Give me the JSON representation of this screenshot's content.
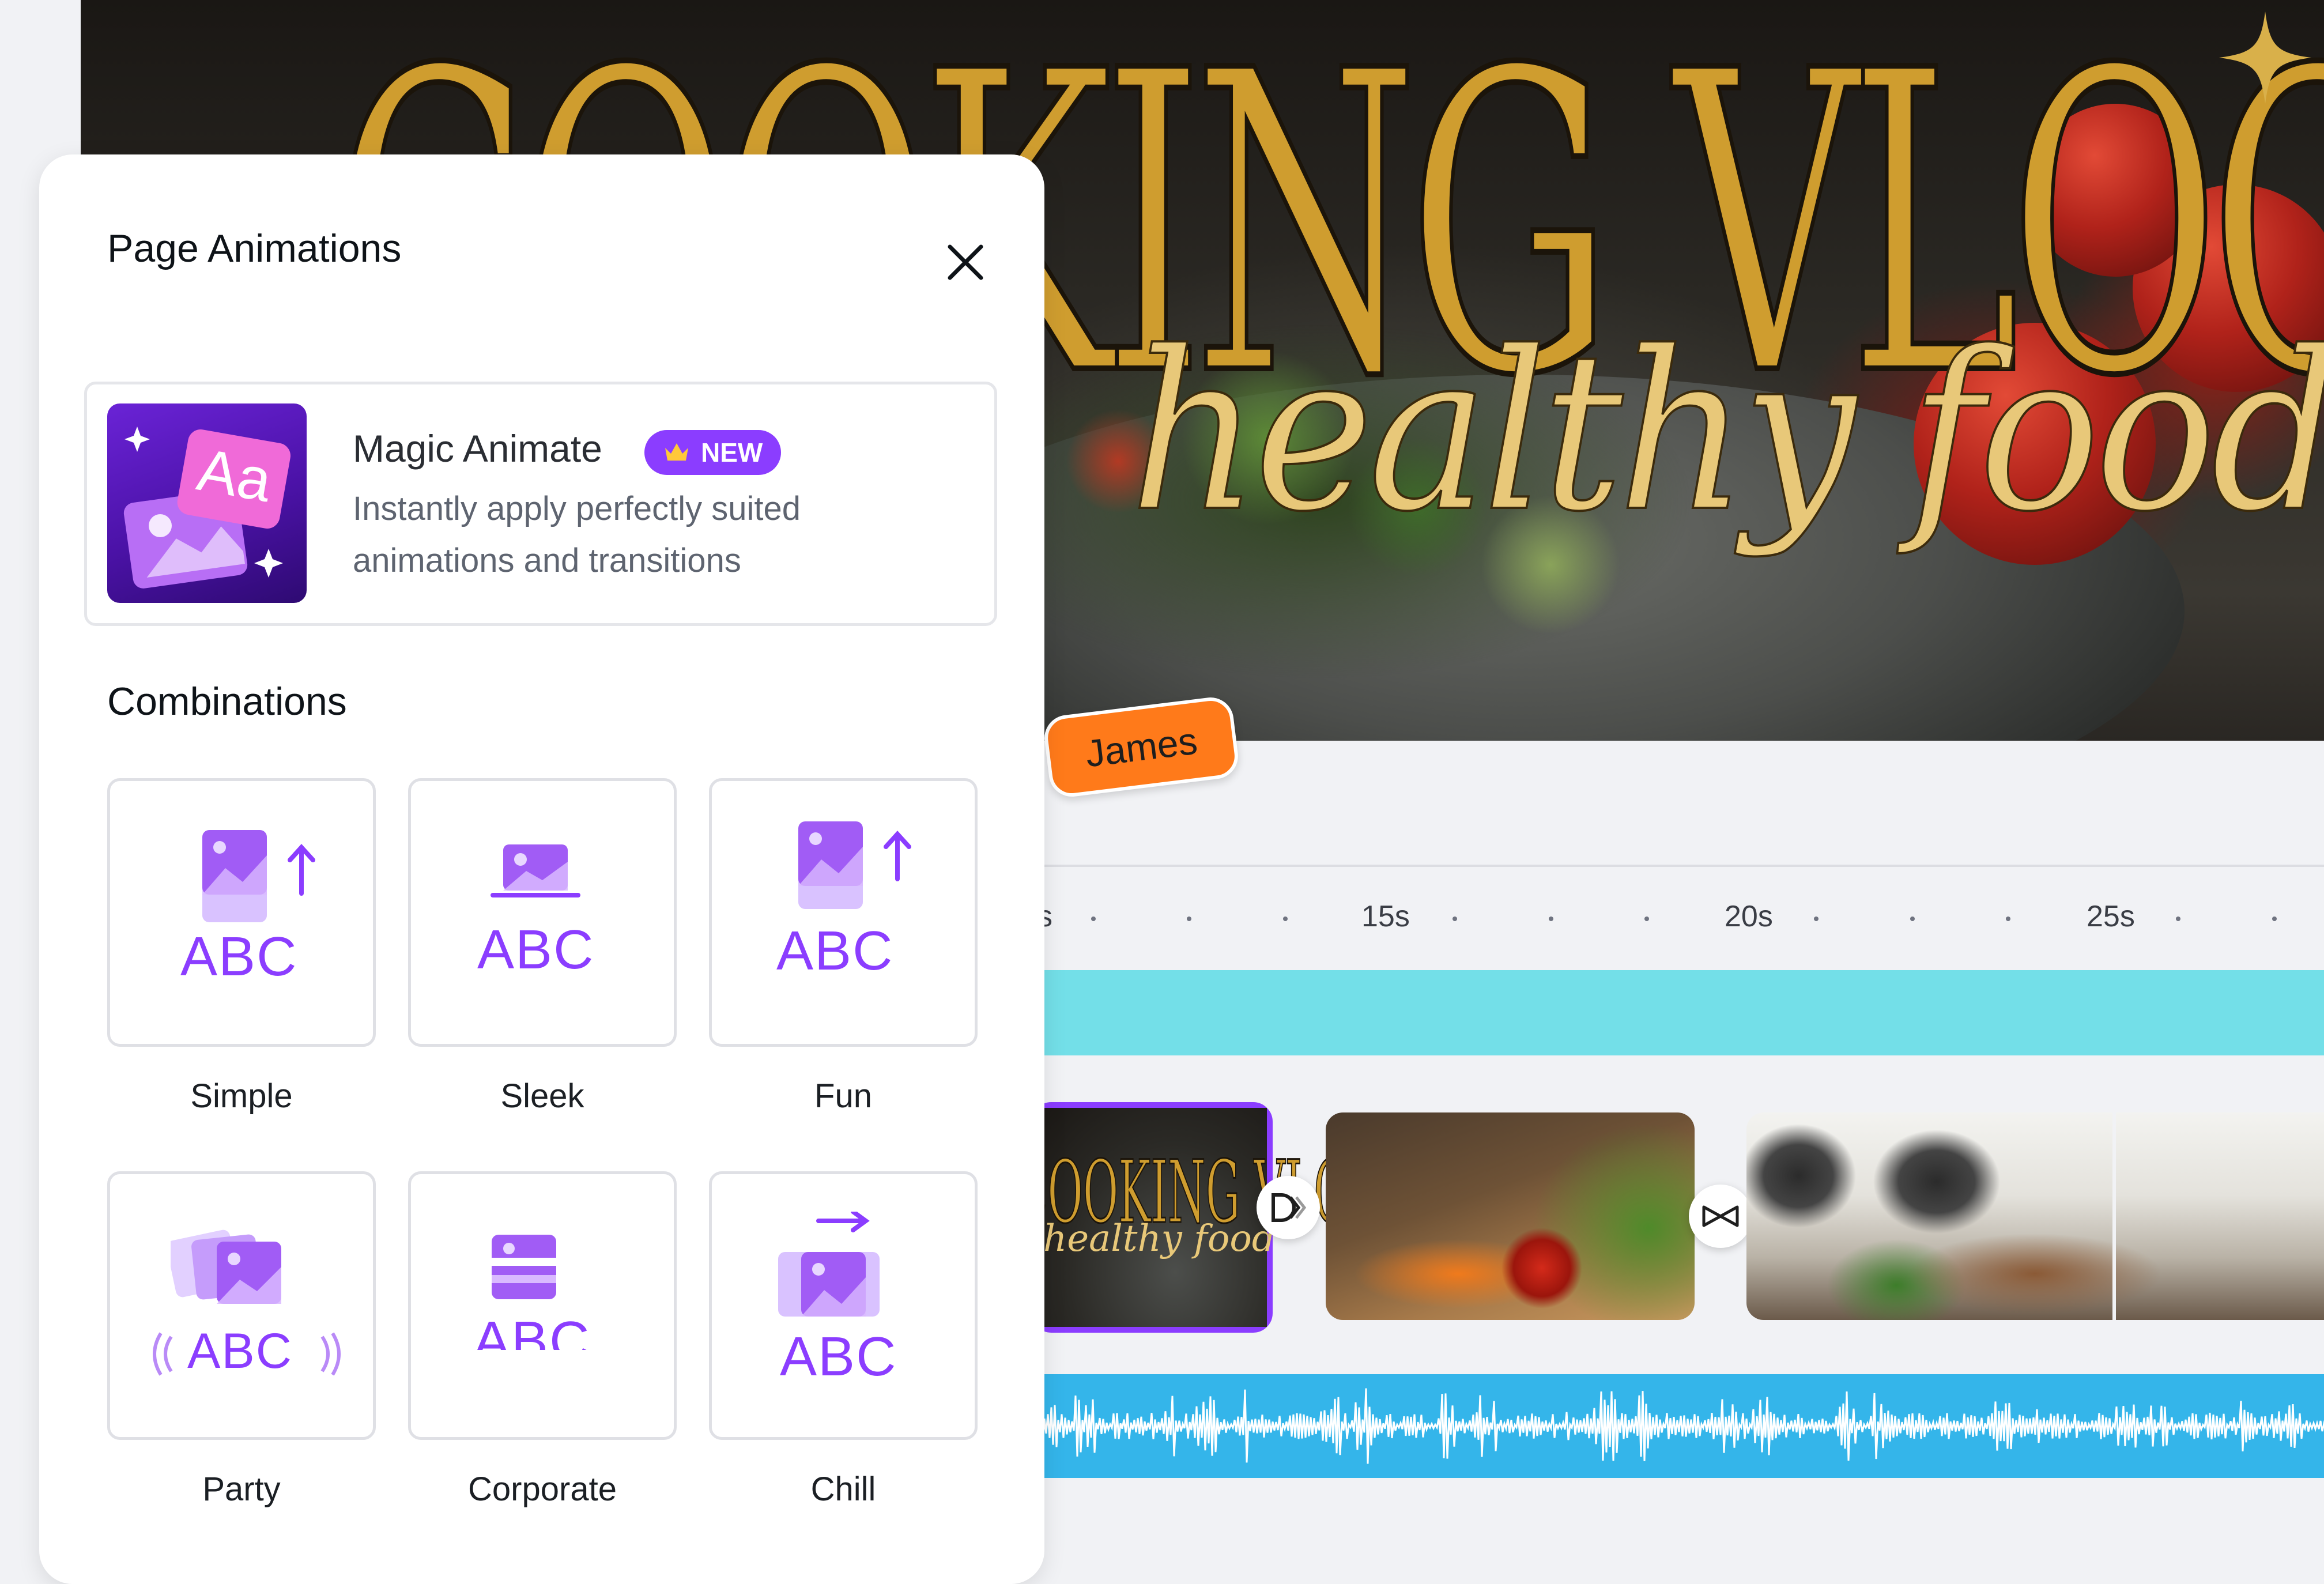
{
  "canvas": {
    "title": "COOKING VLOG",
    "subtitle": "healthy food"
  },
  "timeline": {
    "tick_labels": [
      "s",
      "15s",
      "20s",
      "25s"
    ],
    "clip1_title": "COOKING VLOG",
    "clip1_subtitle": "healthy food"
  },
  "collaborator": {
    "name": "James",
    "color": "#ff7a1a"
  },
  "panel": {
    "title": "Page Animations",
    "magic_animate": {
      "title": "Magic Animate",
      "badge": "NEW",
      "description": "Instantly apply perfectly suited animations and transitions"
    },
    "combinations_title": "Combinations",
    "combinations": [
      {
        "label": "Simple",
        "abc": "ABC"
      },
      {
        "label": "Sleek",
        "abc": "ABC"
      },
      {
        "label": "Fun",
        "abc": "ABC"
      },
      {
        "label": "Party",
        "abc": "ABC"
      },
      {
        "label": "Corporate",
        "abc": "ABC"
      },
      {
        "label": "Chill",
        "abc": "ABC"
      }
    ]
  },
  "colors": {
    "accent": "#8b3dff",
    "text_track": "#73dfe8",
    "audio_track": "#34b5ea",
    "title_gold": "#cf9d2f"
  }
}
